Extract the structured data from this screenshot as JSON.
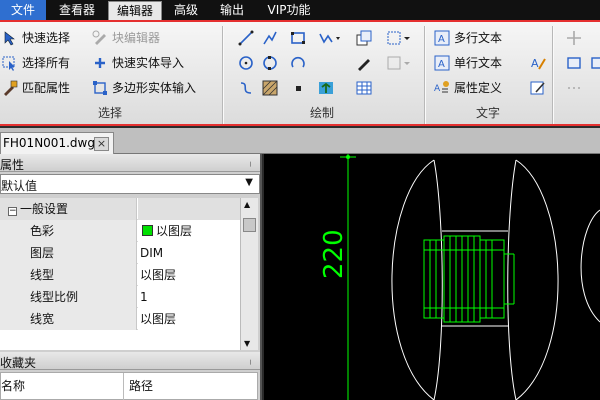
{
  "menubar": {
    "items": [
      {
        "label": "文件"
      },
      {
        "label": "查看器"
      },
      {
        "label": "编辑器"
      },
      {
        "label": "高级"
      },
      {
        "label": "输出"
      },
      {
        "label": "VIP功能"
      }
    ],
    "active": "编辑器"
  },
  "ribbon": {
    "groups": {
      "select": {
        "title": "选择",
        "buttons": [
          {
            "label": "快速选择",
            "icon": "quick-select-icon"
          },
          {
            "label": "选择所有",
            "icon": "select-all-icon"
          },
          {
            "label": "匹配属性",
            "icon": "match-properties-icon"
          },
          {
            "label": "块编辑器",
            "icon": "block-editor-icon",
            "disabled": true
          },
          {
            "label": "快速实体导入",
            "icon": "quick-entity-import-icon"
          },
          {
            "label": "多边形实体输入",
            "icon": "polygon-entity-input-icon"
          }
        ]
      },
      "draw": {
        "title": "绘制",
        "icons": [
          "line-icon",
          "polyline-icon",
          "rectangle-icon",
          "spline-dropdown-icon",
          "insert-block-icon",
          "hatch-dropdown-icon",
          "circle-icon",
          "ellipse-icon",
          "arc-icon",
          "pen-icon",
          "disabled-dropdown-icon",
          "curve-icon",
          "hatch-icon",
          "point-icon",
          "image-icon",
          "table-icon"
        ]
      },
      "text": {
        "title": "文字",
        "buttons": [
          {
            "label": "多行文本",
            "icon": "mtext-icon"
          },
          {
            "label": "单行文本",
            "icon": "text-icon"
          },
          {
            "label": "属性定义",
            "icon": "attribute-definition-icon"
          }
        ]
      }
    }
  },
  "document_tab": {
    "label": "FH01N001.dwg",
    "close": "×"
  },
  "properties_panel": {
    "title": "属性",
    "pin": "ᛧ",
    "dropdown_value": "默认值",
    "dropdown_arrow": "▼",
    "group": {
      "label": "一般设置",
      "expander": "−"
    },
    "rows": [
      {
        "name": "色彩",
        "value": "以图层",
        "swatch": "#00e000"
      },
      {
        "name": "图层",
        "value": "DIM"
      },
      {
        "name": "线型",
        "value": "以图层"
      },
      {
        "name": "线型比例",
        "value": "1"
      },
      {
        "name": "线宽",
        "value": "以图层"
      }
    ],
    "scroll_up": "▲",
    "scroll_down": "▼"
  },
  "favorites_panel": {
    "title": "收藏夹",
    "pin": "ᛧ",
    "columns": [
      "名称",
      "路径"
    ]
  },
  "drawing": {
    "dimension_text": "220",
    "line_color": "#00ff00",
    "outline_color": "#ffffff"
  }
}
